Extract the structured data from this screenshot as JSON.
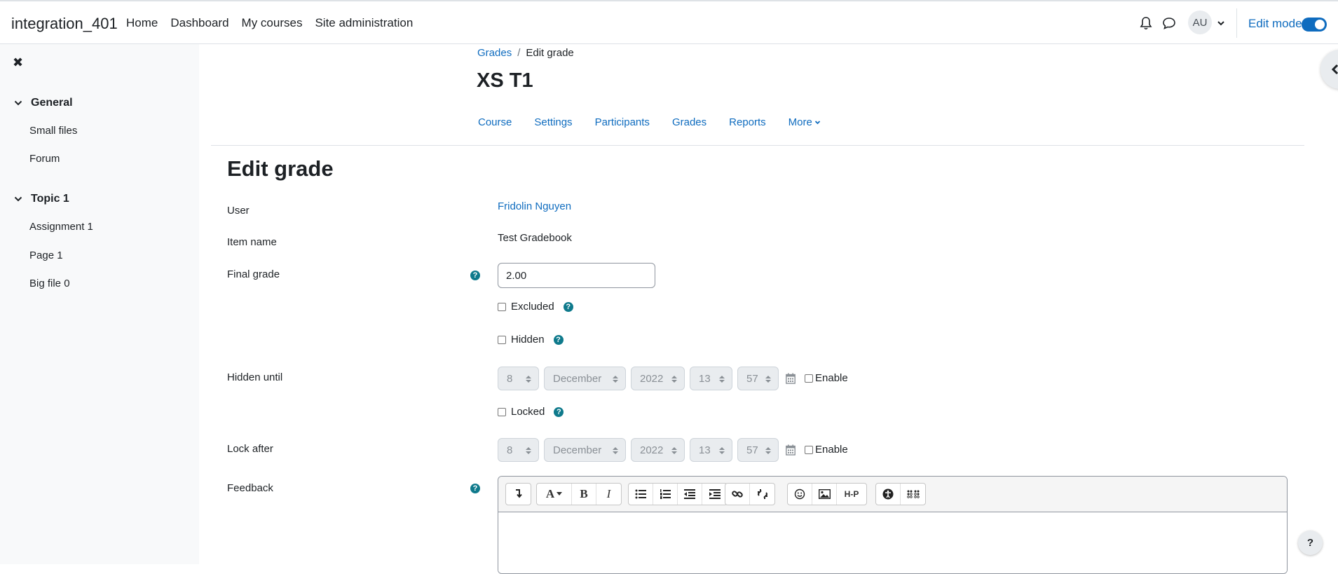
{
  "navbar": {
    "site_name": "integration_401",
    "links": [
      "Home",
      "Dashboard",
      "My courses",
      "Site administration"
    ],
    "avatar_initials": "AU",
    "edit_mode_label": "Edit mode",
    "edit_mode_on": true,
    "icons": [
      "bell-icon",
      "chat-icon",
      "chevron-down-icon"
    ]
  },
  "drawer": {
    "close_icon": "✖",
    "sections": [
      {
        "title": "General",
        "items": [
          "Small files",
          "Forum"
        ]
      },
      {
        "title": "Topic 1",
        "items": [
          "Assignment 1",
          "Page 1",
          "Big file 0"
        ]
      }
    ]
  },
  "header": {
    "breadcrumb": [
      "Grades",
      "Edit grade"
    ],
    "course_title": "XS T1",
    "secondary_nav": [
      "Course",
      "Settings",
      "Participants",
      "Grades",
      "Reports",
      "More"
    ]
  },
  "form": {
    "heading": "Edit grade",
    "user_label": "User",
    "user_value": "Fridolin Nguyen",
    "item_label": "Item name",
    "item_value": "Test Gradebook",
    "final_grade_label": "Final grade",
    "final_grade_value": "2.00",
    "excluded_label": "Excluded",
    "hidden_label": "Hidden",
    "hidden_until_label": "Hidden until",
    "locked_label": "Locked",
    "lock_after_label": "Lock after",
    "feedback_label": "Feedback",
    "enable_label": "Enable",
    "date": {
      "day": "8",
      "month": "December",
      "year": "2022",
      "hour": "13",
      "minute": "57"
    }
  },
  "help_fab": "?",
  "colors": {
    "link": "#0f6cbf",
    "help_icon": "#0f7a8c",
    "drawer_bg": "#f8f9fa"
  }
}
